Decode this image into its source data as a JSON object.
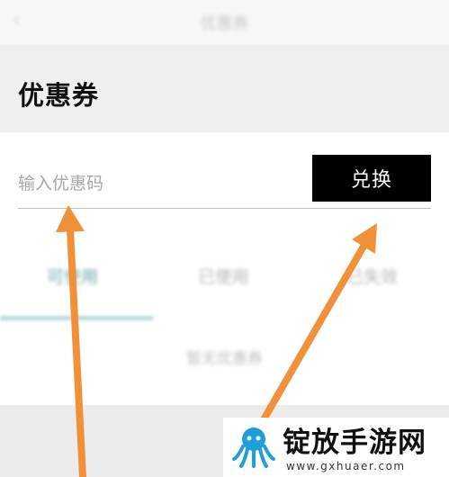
{
  "header": {
    "back_icon": "chevron-left-icon",
    "title": "优惠券"
  },
  "section": {
    "title": "优惠券"
  },
  "redeem": {
    "placeholder": "输入优惠码",
    "button_label": "兑换"
  },
  "tabs": [
    {
      "label": "可使用",
      "active": true
    },
    {
      "label": "已使用",
      "active": false
    },
    {
      "label": "已失效",
      "active": false
    }
  ],
  "empty_state": {
    "text": "暂无优惠券"
  },
  "colors": {
    "active_tab": "#6aa4aa",
    "arrow": "#f0913a",
    "button_bg": "#000000"
  },
  "watermark": {
    "title": "锭放手游网",
    "url": "www.gxhuaer.com"
  }
}
